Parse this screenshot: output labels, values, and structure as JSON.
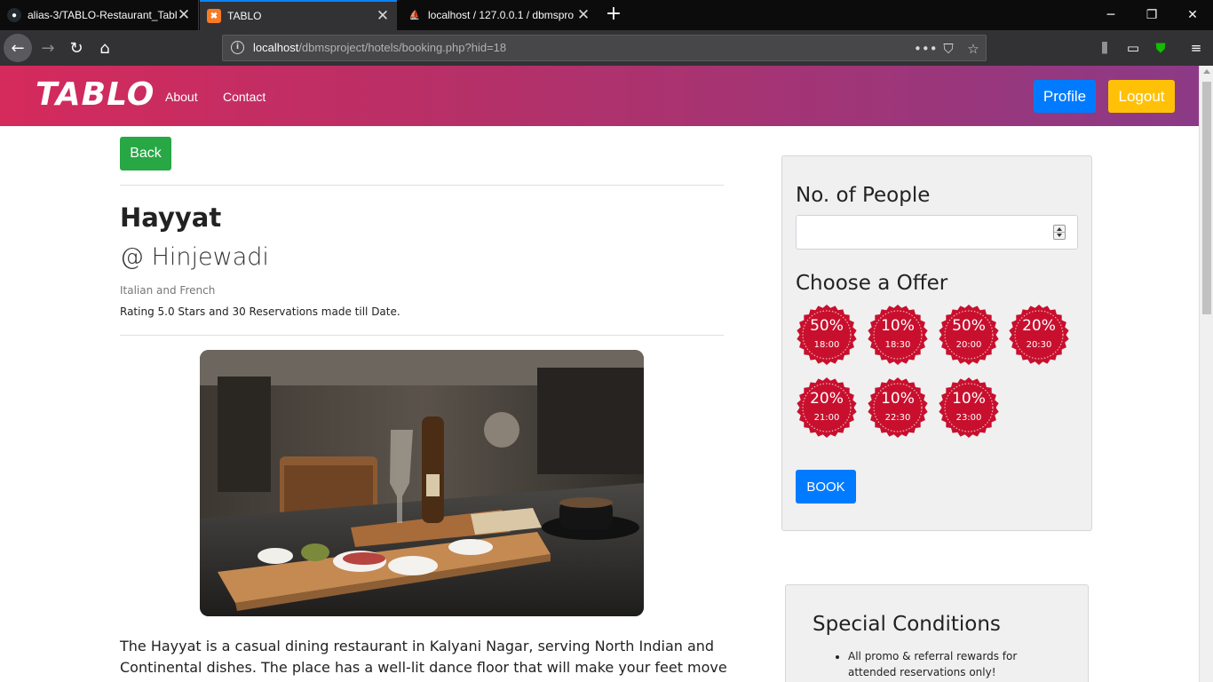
{
  "browser": {
    "tabs": [
      {
        "title": "alias-3/TABLO-Restaurant_Tabl",
        "active": false
      },
      {
        "title": "TABLO",
        "active": true
      },
      {
        "title": "localhost / 127.0.0.1 / dbmspro",
        "active": false
      }
    ],
    "url_host": "localhost",
    "url_path": "/dbmsproject/hotels/booking.php?hid=18"
  },
  "site": {
    "brand": "TABLO",
    "nav_about": "About",
    "nav_contact": "Contact",
    "profile_label": "Profile",
    "logout_label": "Logout",
    "colors": {
      "primary": "#007bff",
      "warning": "#ffc107",
      "success": "#28a745",
      "offer": "#c8102e"
    }
  },
  "restaurant": {
    "back_label": "Back",
    "name": "Hayyat",
    "location": "@ Hinjewadi",
    "cuisine": "Italian and French",
    "rating_text": "Rating 5.0 Stars and 30 Reservations made till Date.",
    "description": "The Hayyat is a casual dining restaurant in Kalyani Nagar, serving North Indian and Continental dishes. The place has a well-lit dance floor that will make your feet move even if you're not"
  },
  "booking": {
    "people_label": "No. of People",
    "people_value": "",
    "offer_heading": "Choose a Offer",
    "offers": [
      {
        "pct": "50%",
        "time": "18:00"
      },
      {
        "pct": "10%",
        "time": "18:30"
      },
      {
        "pct": "50%",
        "time": "20:00"
      },
      {
        "pct": "20%",
        "time": "20:30"
      },
      {
        "pct": "20%",
        "time": "21:00"
      },
      {
        "pct": "10%",
        "time": "22:30"
      },
      {
        "pct": "10%",
        "time": "23:00"
      }
    ],
    "book_label": "BOOK"
  },
  "conditions": {
    "heading": "Special Conditions",
    "items": [
      "All promo & referral rewards for attended reservations only!"
    ]
  }
}
